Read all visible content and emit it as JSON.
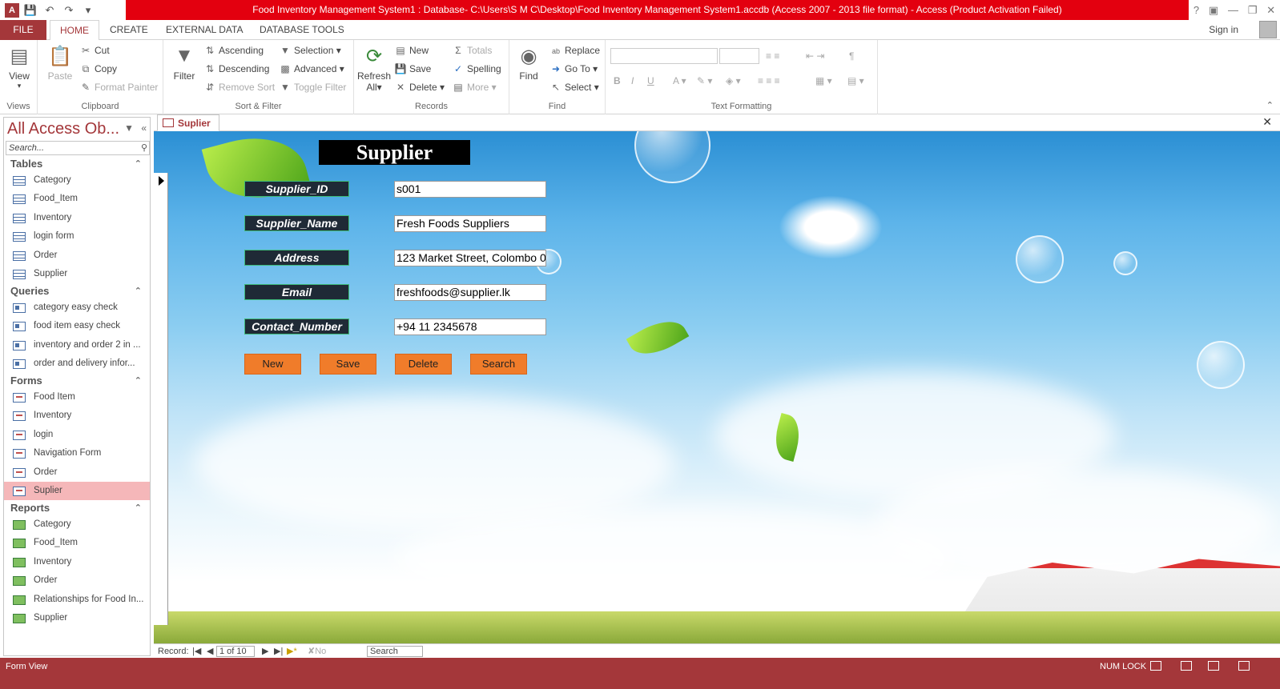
{
  "window": {
    "title": "Food Inventory Management System1 : Database- C:\\Users\\S M C\\Desktop\\Food Inventory Management System1.accdb (Access 2007 - 2013 file format) -  Access (Product Activation Failed)"
  },
  "ribbon_tabs": [
    "FILE",
    "HOME",
    "CREATE",
    "EXTERNAL DATA",
    "DATABASE TOOLS"
  ],
  "account": {
    "sign_in": "Sign in"
  },
  "ribbon": {
    "views": {
      "group": "Views",
      "view": "View"
    },
    "clipboard": {
      "group": "Clipboard",
      "paste": "Paste",
      "cut": "Cut",
      "copy": "Copy",
      "format_painter": "Format Painter"
    },
    "sort_filter": {
      "group": "Sort & Filter",
      "filter": "Filter",
      "ascending": "Ascending",
      "descending": "Descending",
      "remove_sort": "Remove Sort",
      "selection": "Selection",
      "advanced": "Advanced",
      "toggle_filter": "Toggle Filter"
    },
    "records": {
      "group": "Records",
      "refresh": "Refresh",
      "refresh_all": "All",
      "new": "New",
      "save": "Save",
      "delete": "Delete",
      "totals": "Totals",
      "spelling": "Spelling",
      "more": "More"
    },
    "find": {
      "group": "Find",
      "find": "Find",
      "replace": "Replace",
      "goto": "Go To",
      "select": "Select"
    },
    "text_formatting": {
      "group": "Text Formatting"
    }
  },
  "nav_pane": {
    "title": "All Access Ob...",
    "search_placeholder": "Search...",
    "sections": [
      {
        "name": "Tables",
        "items": [
          "Category",
          "Food_Item",
          "Inventory",
          "login form",
          "Order",
          "Supplier"
        ]
      },
      {
        "name": "Queries",
        "items": [
          "category easy check",
          "food item easy check",
          "inventory and order 2 in ...",
          "order and delivery  infor..."
        ]
      },
      {
        "name": "Forms",
        "items": [
          "Food Item",
          "Inventory",
          "login",
          "Navigation Form",
          "Order",
          "Suplier"
        ]
      },
      {
        "name": "Reports",
        "items": [
          "Category",
          "Food_Item",
          "Inventory",
          "Order",
          "Relationships for Food In...",
          "Supplier"
        ]
      }
    ],
    "selected": "Suplier"
  },
  "document_tab": "Suplier",
  "form": {
    "title": "Supplier",
    "fields": [
      {
        "label": "Supplier_ID",
        "value": "s001"
      },
      {
        "label": "Supplier_Name",
        "value": "Fresh Foods Suppliers"
      },
      {
        "label": "Address",
        "value": "123 Market Street, Colombo 0"
      },
      {
        "label": "Email",
        "value": "freshfoods@supplier.lk"
      },
      {
        "label": "Contact_Number",
        "value": "+94 11 2345678"
      }
    ],
    "buttons": [
      "New",
      "Save",
      "Delete",
      "Search"
    ],
    "button_color": "#f07c2a"
  },
  "record_nav": {
    "label": "Record:",
    "position": "1 of 10",
    "filter": "No Filter",
    "search": "Search"
  },
  "status_bar": {
    "view": "Form View",
    "num_lock": "NUM LOCK"
  },
  "colors": {
    "accent": "#a4373a",
    "title_bar": "#e3000f"
  }
}
